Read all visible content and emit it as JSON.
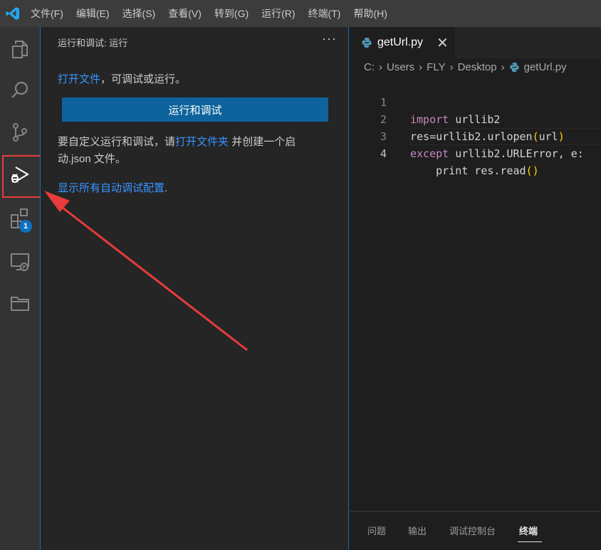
{
  "menubar": {
    "items": [
      "文件(F)",
      "编辑(E)",
      "选择(S)",
      "查看(V)",
      "转到(G)",
      "运行(R)",
      "终端(T)",
      "帮助(H)"
    ]
  },
  "activitybar": {
    "icons": [
      "explorer-icon",
      "search-icon",
      "source-control-icon",
      "run-debug-icon",
      "extensions-icon",
      "remote-explorer-icon",
      "folder-icon"
    ],
    "extensions_badge": "1"
  },
  "sidebar": {
    "title": "运行和调试: 运行",
    "more": "···",
    "open_file_link": "打开文件",
    "open_file_suffix": "，可调试或运行。",
    "run_button": "运行和调试",
    "customize_prefix": "要自定义运行和调试，请",
    "open_folder_link": "打开文件夹",
    "customize_suffix": " 并创建一个启动.json 文件。",
    "show_configs_link": "显示所有自动调试配置",
    "show_configs_suffix": "."
  },
  "editor": {
    "tab_label": "getUrl.py",
    "close_glyph": "✕",
    "breadcrumb": [
      "C:",
      "Users",
      "FLY",
      "Desktop",
      "getUrl.py"
    ],
    "breadcrumb_sep": "›",
    "lines": [
      {
        "num": "1",
        "kw": "import",
        "rest": " urllib2"
      },
      {
        "num": "2",
        "pre": "res=urllib2.urlopen",
        "p1": "(",
        "mid": "url",
        "p2": ")"
      },
      {
        "num": "3",
        "kw": "except",
        "rest": " urllib2.URLError, e:"
      },
      {
        "num": "4",
        "pre": "    print res.read",
        "p1": "(",
        "p2": ")"
      }
    ]
  },
  "panel": {
    "tabs": [
      "问题",
      "输出",
      "调试控制台",
      "终端"
    ],
    "active_tab": "终端"
  },
  "colors": {
    "accent": "#0e639c",
    "link": "#3794ff",
    "keyword": "#c586c0",
    "annotation": "#e83b3b"
  }
}
